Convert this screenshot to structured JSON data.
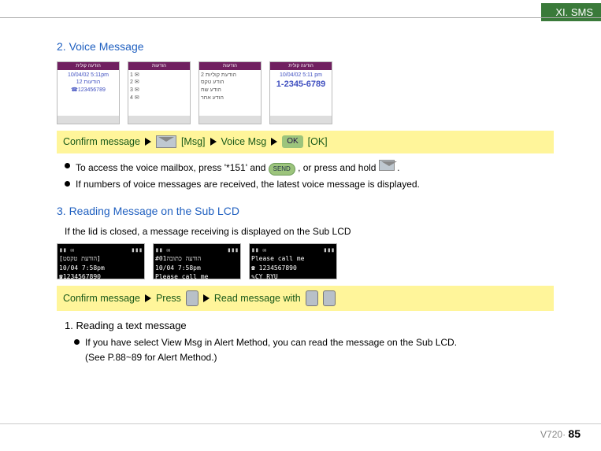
{
  "chapter": "XI. SMS",
  "section2": {
    "title": "2. Voice Message",
    "strip": {
      "confirm": "Confirm message",
      "msg": "[Msg]",
      "voice": "Voice Msg",
      "ok": "[OK]"
    },
    "bullets": [
      "To access the voice mailbox, press '*151' and",
      "If numbers of voice messages are received, the latest voice message is displayed."
    ],
    "bullet1_tail": " , or press and hold",
    "bullet1_end": "."
  },
  "section3": {
    "title": "3. Reading Message on the Sub LCD",
    "intro": "If the lid is closed, a message receiving is displayed on the Sub LCD",
    "strip": {
      "confirm": "Confirm message",
      "press": "Press",
      "read": "Read message with"
    },
    "sub1": {
      "title": "1. Reading a text message",
      "bullet": "If you have select View Msg in Alert Method, you can read the message on the Sub LCD.",
      "note": "(See P.88~89 for Alert Method.)"
    }
  },
  "screens": {
    "s1": {
      "top": "הודעה קולית",
      "l1": "10/04/02   5:11pm",
      "l2": "12 הודעות",
      "l3": "☎123456789"
    },
    "s2": {
      "top": "הודעות",
      "row1": "1 ✉",
      "row2": "2 ✉",
      "row3": "3 ✉",
      "row4": "4 ✉"
    },
    "s3": {
      "top": "הודעות",
      "l1": "2 הודעת קוליות",
      "l2": "הודע טקס",
      "l3": "הודע שח",
      "l4": "הודע אחר"
    },
    "s4": {
      "top": "הודעה קולית",
      "l1": "10/04/02  5:11 pm",
      "l2": "1-2345-6789"
    }
  },
  "sublcd": {
    "a": {
      "l1": "[הודעת טקסט]",
      "l2": "10/04  7:58pm",
      "l3": "☎1234567890"
    },
    "b": {
      "l1": "הודעה כתובה#01",
      "l2": "10/04  7:58pm",
      "l3": "Please call me"
    },
    "c": {
      "l1": "Please call me",
      "l2": "☎ 1234567890",
      "l3": "✎CY RYU"
    }
  },
  "footer": {
    "model": "V720·",
    "page": "85"
  }
}
